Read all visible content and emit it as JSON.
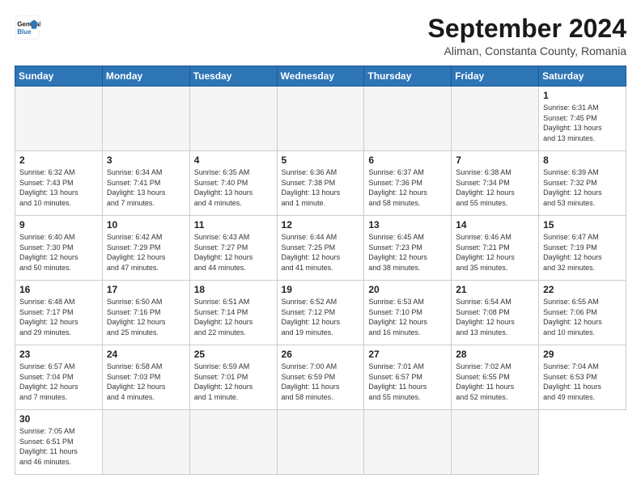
{
  "header": {
    "logo_line1": "General",
    "logo_line2": "Blue",
    "month_title": "September 2024",
    "subtitle": "Aliman, Constanta County, Romania"
  },
  "weekdays": [
    "Sunday",
    "Monday",
    "Tuesday",
    "Wednesday",
    "Thursday",
    "Friday",
    "Saturday"
  ],
  "days": [
    {
      "num": "",
      "info": ""
    },
    {
      "num": "",
      "info": ""
    },
    {
      "num": "",
      "info": ""
    },
    {
      "num": "",
      "info": ""
    },
    {
      "num": "",
      "info": ""
    },
    {
      "num": "",
      "info": ""
    },
    {
      "num": "1",
      "info": "Sunrise: 6:31 AM\nSunset: 7:45 PM\nDaylight: 13 hours\nand 13 minutes."
    },
    {
      "num": "2",
      "info": "Sunrise: 6:32 AM\nSunset: 7:43 PM\nDaylight: 13 hours\nand 10 minutes."
    },
    {
      "num": "3",
      "info": "Sunrise: 6:34 AM\nSunset: 7:41 PM\nDaylight: 13 hours\nand 7 minutes."
    },
    {
      "num": "4",
      "info": "Sunrise: 6:35 AM\nSunset: 7:40 PM\nDaylight: 13 hours\nand 4 minutes."
    },
    {
      "num": "5",
      "info": "Sunrise: 6:36 AM\nSunset: 7:38 PM\nDaylight: 13 hours\nand 1 minute."
    },
    {
      "num": "6",
      "info": "Sunrise: 6:37 AM\nSunset: 7:36 PM\nDaylight: 12 hours\nand 58 minutes."
    },
    {
      "num": "7",
      "info": "Sunrise: 6:38 AM\nSunset: 7:34 PM\nDaylight: 12 hours\nand 55 minutes."
    },
    {
      "num": "8",
      "info": "Sunrise: 6:39 AM\nSunset: 7:32 PM\nDaylight: 12 hours\nand 53 minutes."
    },
    {
      "num": "9",
      "info": "Sunrise: 6:40 AM\nSunset: 7:30 PM\nDaylight: 12 hours\nand 50 minutes."
    },
    {
      "num": "10",
      "info": "Sunrise: 6:42 AM\nSunset: 7:29 PM\nDaylight: 12 hours\nand 47 minutes."
    },
    {
      "num": "11",
      "info": "Sunrise: 6:43 AM\nSunset: 7:27 PM\nDaylight: 12 hours\nand 44 minutes."
    },
    {
      "num": "12",
      "info": "Sunrise: 6:44 AM\nSunset: 7:25 PM\nDaylight: 12 hours\nand 41 minutes."
    },
    {
      "num": "13",
      "info": "Sunrise: 6:45 AM\nSunset: 7:23 PM\nDaylight: 12 hours\nand 38 minutes."
    },
    {
      "num": "14",
      "info": "Sunrise: 6:46 AM\nSunset: 7:21 PM\nDaylight: 12 hours\nand 35 minutes."
    },
    {
      "num": "15",
      "info": "Sunrise: 6:47 AM\nSunset: 7:19 PM\nDaylight: 12 hours\nand 32 minutes."
    },
    {
      "num": "16",
      "info": "Sunrise: 6:48 AM\nSunset: 7:17 PM\nDaylight: 12 hours\nand 29 minutes."
    },
    {
      "num": "17",
      "info": "Sunrise: 6:50 AM\nSunset: 7:16 PM\nDaylight: 12 hours\nand 25 minutes."
    },
    {
      "num": "18",
      "info": "Sunrise: 6:51 AM\nSunset: 7:14 PM\nDaylight: 12 hours\nand 22 minutes."
    },
    {
      "num": "19",
      "info": "Sunrise: 6:52 AM\nSunset: 7:12 PM\nDaylight: 12 hours\nand 19 minutes."
    },
    {
      "num": "20",
      "info": "Sunrise: 6:53 AM\nSunset: 7:10 PM\nDaylight: 12 hours\nand 16 minutes."
    },
    {
      "num": "21",
      "info": "Sunrise: 6:54 AM\nSunset: 7:08 PM\nDaylight: 12 hours\nand 13 minutes."
    },
    {
      "num": "22",
      "info": "Sunrise: 6:55 AM\nSunset: 7:06 PM\nDaylight: 12 hours\nand 10 minutes."
    },
    {
      "num": "23",
      "info": "Sunrise: 6:57 AM\nSunset: 7:04 PM\nDaylight: 12 hours\nand 7 minutes."
    },
    {
      "num": "24",
      "info": "Sunrise: 6:58 AM\nSunset: 7:03 PM\nDaylight: 12 hours\nand 4 minutes."
    },
    {
      "num": "25",
      "info": "Sunrise: 6:59 AM\nSunset: 7:01 PM\nDaylight: 12 hours\nand 1 minute."
    },
    {
      "num": "26",
      "info": "Sunrise: 7:00 AM\nSunset: 6:59 PM\nDaylight: 11 hours\nand 58 minutes."
    },
    {
      "num": "27",
      "info": "Sunrise: 7:01 AM\nSunset: 6:57 PM\nDaylight: 11 hours\nand 55 minutes."
    },
    {
      "num": "28",
      "info": "Sunrise: 7:02 AM\nSunset: 6:55 PM\nDaylight: 11 hours\nand 52 minutes."
    },
    {
      "num": "29",
      "info": "Sunrise: 7:04 AM\nSunset: 6:53 PM\nDaylight: 11 hours\nand 49 minutes."
    },
    {
      "num": "30",
      "info": "Sunrise: 7:05 AM\nSunset: 6:51 PM\nDaylight: 11 hours\nand 46 minutes."
    },
    {
      "num": "",
      "info": ""
    },
    {
      "num": "",
      "info": ""
    },
    {
      "num": "",
      "info": ""
    },
    {
      "num": "",
      "info": ""
    },
    {
      "num": "",
      "info": ""
    }
  ]
}
